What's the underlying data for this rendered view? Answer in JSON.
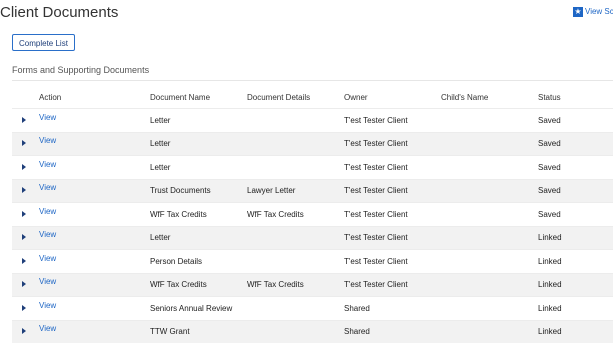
{
  "page": {
    "title": "Client Documents"
  },
  "header_link": {
    "label": "View Sca",
    "icon": "star-icon"
  },
  "buttons": {
    "complete_list": "Complete List"
  },
  "section": {
    "title": "Forms and Supporting Documents"
  },
  "table": {
    "columns": [
      "",
      "Action",
      "Document Name",
      "Document Details",
      "Owner",
      "Child's Name",
      "Status"
    ],
    "rows": [
      {
        "action": "View",
        "name": "Letter",
        "details": "",
        "owner": "T'est Tester Client",
        "child": "",
        "status": "Saved"
      },
      {
        "action": "View",
        "name": "Letter",
        "details": "",
        "owner": "T'est Tester Client",
        "child": "",
        "status": "Saved"
      },
      {
        "action": "View",
        "name": "Letter",
        "details": "",
        "owner": "T'est Tester Client",
        "child": "",
        "status": "Saved"
      },
      {
        "action": "View",
        "name": "Trust Documents",
        "details": "Lawyer Letter",
        "owner": "T'est Tester Client",
        "child": "",
        "status": "Saved"
      },
      {
        "action": "View",
        "name": "WfF Tax Credits",
        "details": "WfF Tax Credits",
        "owner": "T'est Tester Client",
        "child": "",
        "status": "Saved"
      },
      {
        "action": "View",
        "name": "Letter",
        "details": "",
        "owner": "T'est Tester Client",
        "child": "",
        "status": "Linked"
      },
      {
        "action": "View",
        "name": "Person Details",
        "details": "",
        "owner": "T'est Tester Client",
        "child": "",
        "status": "Linked"
      },
      {
        "action": "View",
        "name": "WfF Tax Credits",
        "details": "WfF Tax Credits",
        "owner": "T'est Tester Client",
        "child": "",
        "status": "Linked"
      },
      {
        "action": "View",
        "name": "Seniors Annual Review",
        "details": "",
        "owner": "Shared",
        "child": "",
        "status": "Linked"
      },
      {
        "action": "View",
        "name": "TTW Grant",
        "details": "",
        "owner": "Shared",
        "child": "",
        "status": "Linked"
      }
    ]
  },
  "colors": {
    "accent": "#1e66c5",
    "button_text": "#1f3f7a",
    "row_alt": "#f2f2f2"
  }
}
